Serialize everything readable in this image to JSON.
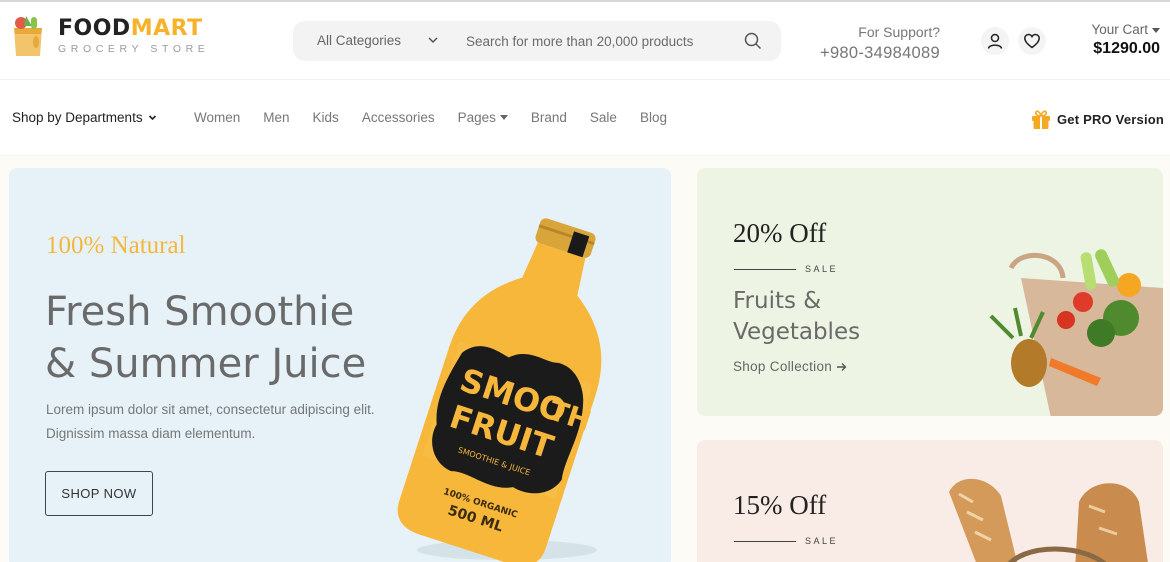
{
  "brand": {
    "name_primary": "FOOD",
    "name_accent": "MART",
    "tagline": "GROCERY STORE"
  },
  "search": {
    "category": "All Categories",
    "placeholder": "Search for more than 20,000 products"
  },
  "support": {
    "label": "For Support?",
    "phone": "+980-34984089"
  },
  "cart": {
    "label": "Your Cart",
    "total": "$1290.00"
  },
  "nav": {
    "departments": "Shop by Departments",
    "links": [
      "Women",
      "Men",
      "Kids",
      "Accessories",
      "Pages",
      "Brand",
      "Sale",
      "Blog"
    ],
    "pro": "Get PRO Version"
  },
  "hero": {
    "eyebrow": "100% Natural",
    "title_line1": "Fresh Smoothie",
    "title_line2": "& Summer Juice",
    "description": "Lorem ipsum dolor sit amet, consectetur adipiscing elit. Dignissim massa diam elementum.",
    "button": "SHOP NOW",
    "bottle_label_1": "SMOO",
    "bottle_label_2": "TH",
    "bottle_label_3": "FRUIT",
    "bottle_sub": "SMOOTHIE & JUICE",
    "bottle_org": "100% ORGANIC",
    "bottle_vol": "500 ML"
  },
  "promos": [
    {
      "off": "20% Off",
      "sale": "SALE",
      "title": "Fruits & Vegetables",
      "link": "Shop Collection"
    },
    {
      "off": "15% Off",
      "sale": "SALE"
    }
  ],
  "colors": {
    "accent": "#f7b22a",
    "hero_bg": "#e6f2f8",
    "promo_green": "#eef4e3",
    "promo_pink": "#f9ebe5"
  }
}
